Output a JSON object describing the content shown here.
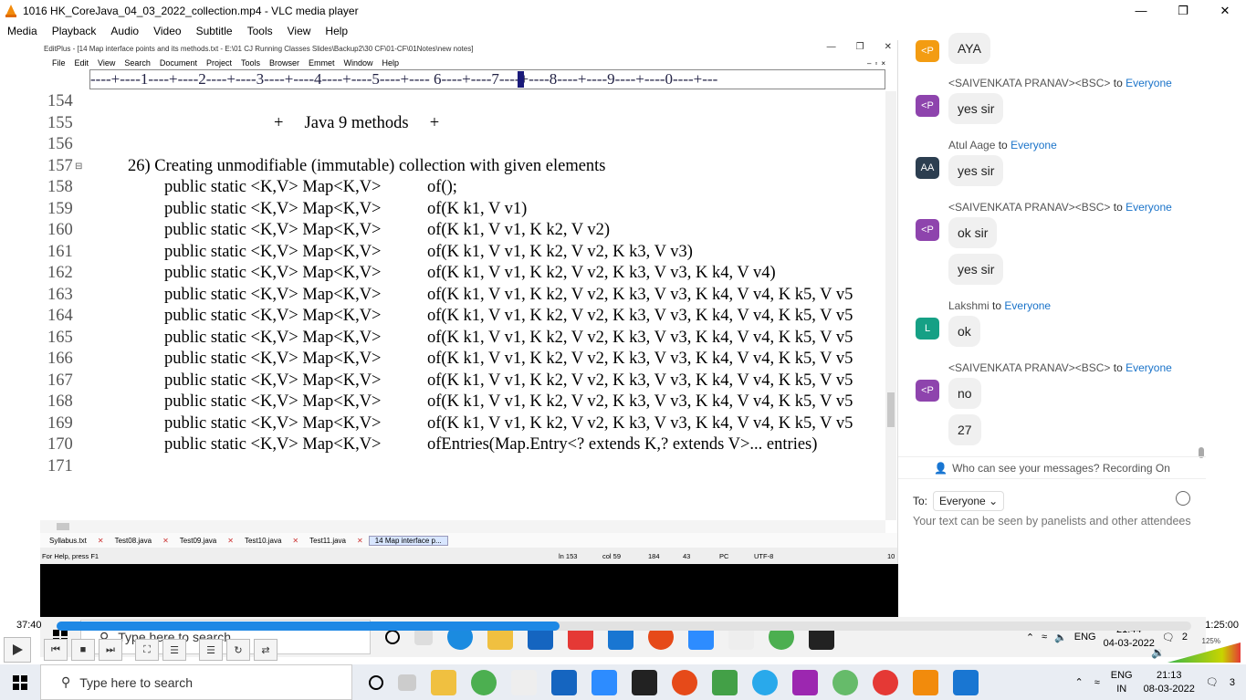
{
  "vlc": {
    "title": "1016 HK_CoreJava_04_03_2022_collection.mp4 - VLC media player",
    "menu": [
      "Media",
      "Playback",
      "Audio",
      "Video",
      "Subtitle",
      "Tools",
      "View",
      "Help"
    ],
    "time_elapsed": "37:40",
    "time_total": "1:25:00",
    "progress": 0.443,
    "volume_label": "125%",
    "volume_level": 1.25
  },
  "editplus": {
    "title": "EditPlus - [14 Map interface points and its methods.txt - E:\\01 CJ Running Classes Slides\\Backup2\\30 CF\\01-CF\\01Notes\\new notes]",
    "menu": [
      "File",
      "Edit",
      "View",
      "Search",
      "Document",
      "Project",
      "Tools",
      "Browser",
      "Emmet",
      "Window",
      "Help"
    ],
    "ruler": "----+----1----+----2----+----3----+----4----+----5----+---- 6----+----7----+----8----+----9----+----0----+---",
    "lines": [
      {
        "n": "154",
        "text": ""
      },
      {
        "n": "155",
        "text": "+     Java 9 methods     +"
      },
      {
        "n": "156",
        "text": ""
      },
      {
        "n": "157",
        "text": "26) Creating unmodifiable (immutable) collection with given elements"
      },
      {
        "n": "158",
        "sig": "public static <K,V> Map<K,V>",
        "text": "of();"
      },
      {
        "n": "159",
        "sig": "public static <K,V> Map<K,V>",
        "text": "of(K k1, V v1)"
      },
      {
        "n": "160",
        "sig": "public static <K,V> Map<K,V>",
        "text": "of(K k1, V v1, K k2, V v2)"
      },
      {
        "n": "161",
        "sig": "public static <K,V> Map<K,V>",
        "text": "of(K k1, V v1, K k2, V v2, K k3, V v3)"
      },
      {
        "n": "162",
        "sig": "public static <K,V> Map<K,V>",
        "text": "of(K k1, V v1, K k2, V v2, K k3, V v3, K k4, V v4)"
      },
      {
        "n": "163",
        "sig": "public static <K,V> Map<K,V>",
        "text": "of(K k1, V v1, K k2, V v2, K k3, V v3, K k4, V v4, K k5, V v5"
      },
      {
        "n": "164",
        "sig": "public static <K,V> Map<K,V>",
        "text": "of(K k1, V v1, K k2, V v2, K k3, V v3, K k4, V v4, K k5, V v5"
      },
      {
        "n": "165",
        "sig": "public static <K,V> Map<K,V>",
        "text": "of(K k1, V v1, K k2, V v2, K k3, V v3, K k4, V v4, K k5, V v5"
      },
      {
        "n": "166",
        "sig": "public static <K,V> Map<K,V>",
        "text": "of(K k1, V v1, K k2, V v2, K k3, V v3, K k4, V v4, K k5, V v5"
      },
      {
        "n": "167",
        "sig": "public static <K,V> Map<K,V>",
        "text": "of(K k1, V v1, K k2, V v2, K k3, V v3, K k4, V v4, K k5, V v5"
      },
      {
        "n": "168",
        "sig": "public static <K,V> Map<K,V>",
        "text": "of(K k1, V v1, K k2, V v2, K k3, V v3, K k4, V v4, K k5, V v5"
      },
      {
        "n": "169",
        "sig": "public static <K,V> Map<K,V>",
        "text": "of(K k1, V v1, K k2, V v2, K k3, V v3, K k4, V v4, K k5, V v5"
      },
      {
        "n": "170",
        "sig": "public static <K,V> Map<K,V>",
        "text": "ofEntries(Map.Entry<? extends K,? extends V>... entries)"
      },
      {
        "n": "171",
        "text": ""
      }
    ],
    "tabs": [
      "Syllabus.txt",
      "Test08.java",
      "Test09.java",
      "Test10.java",
      "Test11.java",
      "14 Map interface p..."
    ],
    "status": {
      "help": "For Help, press F1",
      "ln": "ln 153",
      "col": "col 59",
      "a": "184",
      "b": "43",
      "mode": "PC",
      "enc": "UTF-8",
      "c": "10"
    }
  },
  "chat": {
    "messages": [
      {
        "avatar": "<P",
        "color": "#f39c12",
        "text": "AYA"
      },
      {
        "sender": "<SAIVENKATA PRANAV><BSC>",
        "avatar": "<P",
        "color": "#8e44ad",
        "text": "yes sir"
      },
      {
        "sender": "Atul Aage",
        "avatar": "AA",
        "color": "#2c3e50",
        "text": "yes sir"
      },
      {
        "sender": "<SAIVENKATA PRANAV><BSC>",
        "avatar": "<P",
        "color": "#8e44ad",
        "text": "ok sir",
        "extra": "yes sir"
      },
      {
        "sender": "Lakshmi",
        "avatar": "L",
        "color": "#16a085",
        "text": "ok"
      },
      {
        "sender": "<SAIVENKATA PRANAV><BSC>",
        "avatar": "<P",
        "color": "#8e44ad",
        "text": "no",
        "extra": "27"
      }
    ],
    "to_word": "to",
    "everyone": "Everyone",
    "who_text": "Who can see your messages? Recording On",
    "to_label": "To:",
    "to_value": "Everyone",
    "placeholder": "Your text can be seen by panelists and other attendees"
  },
  "taskbar_inner": {
    "search": "Type here to search",
    "time": "21:44",
    "date": "04-03-2022",
    "lang": "ENG",
    "notif": "2"
  },
  "taskbar_outer": {
    "search": "Type here to search",
    "time": "21:13",
    "date": "08-03-2022",
    "lang": "ENG",
    "region": "IN",
    "notif": "3"
  },
  "colors": {
    "accent": "#1e88e5",
    "chat_link": "#1a73c9"
  }
}
